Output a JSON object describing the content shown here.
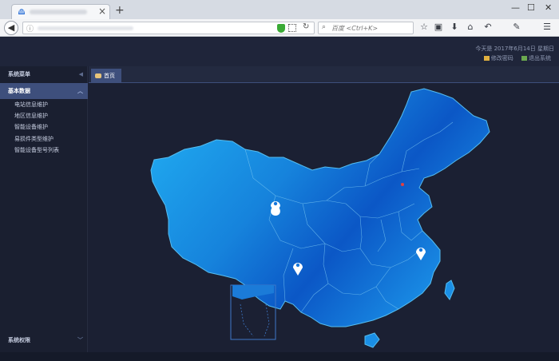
{
  "browser": {
    "search_placeholder": "百度 <Ctrl+K>",
    "new_tab": "+",
    "tab_close": "×",
    "minimize": "—",
    "maximize": "☐",
    "close": "✕"
  },
  "header": {
    "date_text": "今天是 2017年6月14日 星期日",
    "change_password": "修改密码",
    "logout": "退出系统"
  },
  "sidebar": {
    "system_menu": "系统菜单",
    "group": "基本数据",
    "items": [
      {
        "label": "电站信息维护"
      },
      {
        "label": "地区信息维护"
      },
      {
        "label": "智能设备维护"
      },
      {
        "label": "易损件类型维护"
      },
      {
        "label": "智能设备型号列表"
      }
    ],
    "permissions": "系统权限"
  },
  "content": {
    "home_tab": "首页"
  },
  "map": {
    "colors": {
      "light": "#1ea8f0",
      "dark": "#0a56c8",
      "border": "#4fb4ea"
    },
    "markers": [
      {
        "label": "marker-west"
      },
      {
        "label": "marker-southwest"
      },
      {
        "label": "marker-east"
      }
    ],
    "capital_marker_color": "#e04040"
  }
}
